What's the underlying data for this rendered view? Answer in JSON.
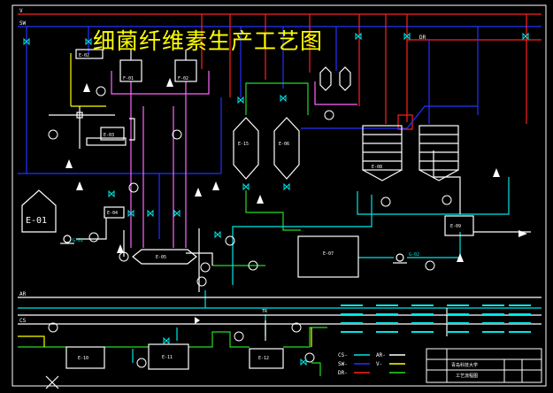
{
  "title": "细菌纤维素生产工艺图",
  "line_labels": {
    "v": "V",
    "sw": "SW",
    "ar": "AR",
    "cs": "CS",
    "dr": "DR",
    "tr": "TR"
  },
  "equipment": {
    "e01": "E-01",
    "e02": "E-02",
    "e03": "E-03",
    "e04": "E-04",
    "e05": "E-05",
    "e06": "E-06",
    "e07": "E-07",
    "e08": "E-08",
    "e09": "E-09",
    "e10": "E-10",
    "e11": "E-11",
    "e12": "E-12",
    "e15": "E-15",
    "f01": "F-01",
    "f02": "F-02",
    "g01": "G-01",
    "g02": "G-02"
  },
  "legend": {
    "cs": "CS-",
    "sw": "SW-",
    "dr": "DR-",
    "ar": "AR-",
    "v": "V-"
  },
  "title_block": {
    "name": "青岛科技大学",
    "drawing": "工艺流程图"
  },
  "colors": {
    "line_yellow": "#ffff00",
    "line_red": "#ff2020",
    "line_blue": "#2233ff",
    "line_cyan": "#00e5e5",
    "line_green": "#22dd22",
    "line_magenta": "#ff66ff",
    "equipment_white": "#ffffff"
  }
}
